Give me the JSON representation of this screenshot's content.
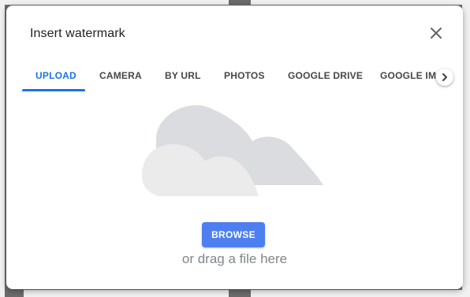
{
  "dialog": {
    "title": "Insert watermark",
    "close_icon": "close-icon"
  },
  "tabs": [
    {
      "label": "UPLOAD",
      "active": true
    },
    {
      "label": "CAMERA",
      "active": false
    },
    {
      "label": "BY URL",
      "active": false
    },
    {
      "label": "PHOTOS",
      "active": false
    },
    {
      "label": "GOOGLE DRIVE",
      "active": false
    },
    {
      "label": "GOOGLE IMAGES",
      "active": false
    }
  ],
  "tab_scroll_icon": "chevron-right-icon",
  "upload": {
    "illustration_icon": "cloud-icon",
    "browse_label": "BROWSE",
    "drag_text": "or drag a file here"
  },
  "colors": {
    "accent": "#1a73e8",
    "button": "#4d7ff0",
    "cloud_back": "#dadce0",
    "cloud_front": "#ebebeb"
  }
}
